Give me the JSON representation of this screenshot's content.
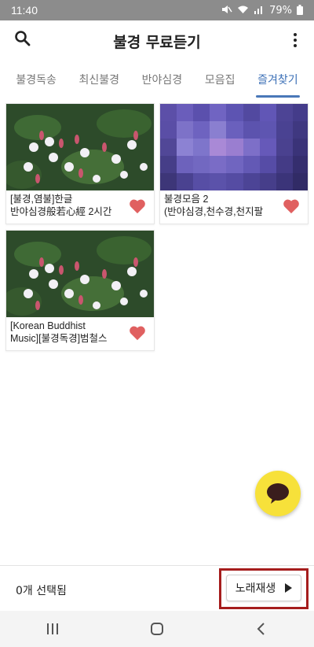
{
  "status": {
    "time": "11:40",
    "battery": "79%"
  },
  "appbar": {
    "title": "불경 무료듣기",
    "search_icon": "search-icon",
    "more_icon": "more-vert-icon"
  },
  "tabs": [
    {
      "label": "불경독송",
      "active": false
    },
    {
      "label": "최신불경",
      "active": false
    },
    {
      "label": "반야심경",
      "active": false
    },
    {
      "label": "모음집",
      "active": false
    },
    {
      "label": "즐겨찾기",
      "active": true
    }
  ],
  "cards": [
    {
      "line1": "[불경,염불]한글",
      "line2": "반야심경般若心經 2시간",
      "favorited": true,
      "thumb": "flowers"
    },
    {
      "line1": "불경모음 2",
      "line2": "(반야심경,천수경,천지팔",
      "favorited": true,
      "thumb": "pixelated"
    },
    {
      "line1": "[Korean Buddhist",
      "line2": "Music][불경독경]범철스",
      "favorited": true,
      "thumb": "flowers"
    }
  ],
  "bottom": {
    "selected_count": "0개 선택됨",
    "play_label": "노래재생"
  },
  "colors": {
    "accent": "#3b6fb6",
    "heart": "#e06060",
    "fab": "#f7e13a",
    "highlight": "#a51d1d"
  }
}
